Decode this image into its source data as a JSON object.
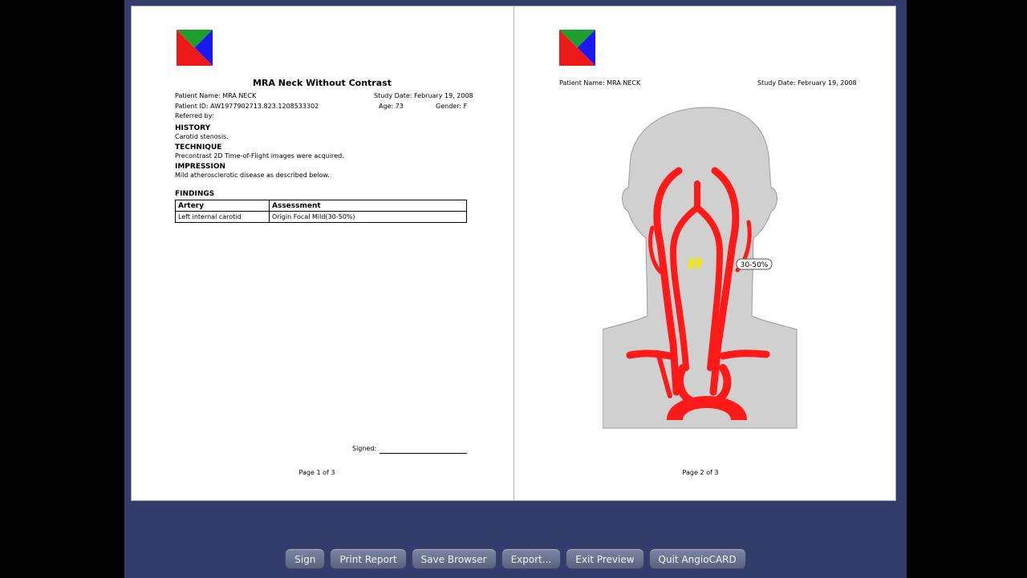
{
  "report": {
    "title": "MRA Neck Without Contrast",
    "patient_name": "Patient Name: MRA NECK",
    "study_date": "Study Date: February 19, 2008",
    "patient_id": "Patient ID: AW1977902713.823.1208533302",
    "age": "Age: 73",
    "gender": "Gender: F",
    "referred_by": "Referred by:",
    "history_heading": "HISTORY",
    "history_text": "Carotid stenosis.",
    "technique_heading": "TECHNIQUE",
    "technique_text": "Precontrast 2D Time-of-Flight images were acquired.",
    "impression_heading": "IMPRESSION",
    "impression_text": "Mild atherosclerotic disease as described below.",
    "findings_heading": "FINDINGS",
    "findings_columns": [
      "Artery",
      "Assessment"
    ],
    "findings_rows": [
      [
        "Left internal carotid",
        "Origin Focal Mild(30-50%)"
      ]
    ],
    "signed_label": "Signed:",
    "page1_label": "Page 1 of 3"
  },
  "page2": {
    "patient_name": "Patient Name: MRA NECK",
    "study_date": "Study Date: February 19, 2008",
    "stenosis_label": "30-50%",
    "page_label": "Page 2 of 3"
  },
  "buttons": {
    "sign": "Sign",
    "print_report": "Print Report",
    "save_browser": "Save Browser",
    "export": "Export...",
    "exit_preview": "Exit Preview",
    "quit": "Quit AngioCARD"
  },
  "colors": {
    "app_background": "#333d6b",
    "artery": "#ff1a1a",
    "stenosis_marker": "#f2ea00",
    "silhouette": "#d0d0d0"
  },
  "icons": {
    "logo": "quadrant-logo-icon"
  }
}
